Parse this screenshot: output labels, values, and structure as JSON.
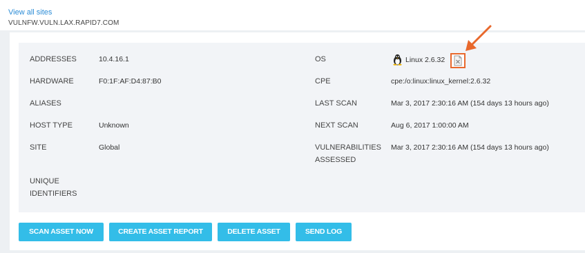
{
  "header": {
    "back_link": "View all sites",
    "hostname": "VULNFW.VULN.LAX.RAPID7.COM"
  },
  "left": {
    "addresses_label": "ADDRESSES",
    "addresses_value": "10.4.16.1",
    "hardware_label": "HARDWARE",
    "hardware_value": "F0:1F:AF:D4:87:B0",
    "aliases_label": "ALIASES",
    "host_type_label": "HOST TYPE",
    "host_type_value": "Unknown",
    "site_label": "SITE",
    "site_value": "Global",
    "unique_ids_label_1": "UNIQUE",
    "unique_ids_label_2": "IDENTIFIERS"
  },
  "right": {
    "os_label": "OS",
    "os_value": "Linux 2.6.32",
    "cpe_label": "CPE",
    "cpe_value": "cpe:/o:linux:linux_kernel:2.6.32",
    "last_scan_label": "LAST SCAN",
    "last_scan_value": "Mar 3, 2017 2:30:16 AM (154 days 13 hours ago)",
    "next_scan_label": "NEXT SCAN",
    "next_scan_value": "Aug 6, 2017 1:00:00 AM",
    "vulns_label_1": "VULNERABILITIES",
    "vulns_label_2": "ASSESSED",
    "vulns_value": "Mar 3, 2017 2:30:16 AM (154 days 13 hours ago)"
  },
  "buttons": {
    "scan": "SCAN ASSET NOW",
    "report": "CREATE ASSET REPORT",
    "delete": "DELETE ASSET",
    "log": "SEND LOG"
  },
  "colors": {
    "button": "#33bde8",
    "link": "#2b8cd6",
    "highlight": "#e8682c"
  },
  "icons": {
    "os": "linux-tux-icon",
    "fingerprint": "document-x-icon",
    "annotation": "arrow-icon"
  }
}
